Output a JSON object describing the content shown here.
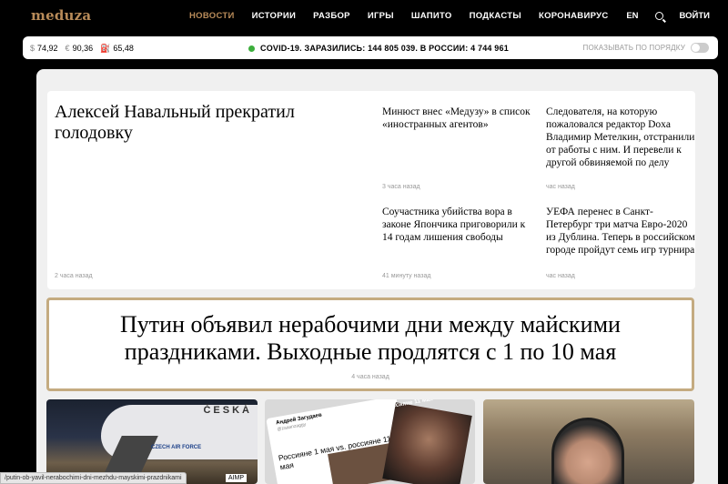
{
  "header": {
    "logo": "meduza",
    "nav": [
      "НОВОСТИ",
      "ИСТОРИИ",
      "РАЗБОР",
      "ИГРЫ",
      "ШАПИТО",
      "ПОДКАСТЫ",
      "КОРОНАВИРУС"
    ],
    "lang": "EN",
    "login": "ВОЙТИ",
    "search_icon": "search-icon"
  },
  "ticker": {
    "usd_sym": "$",
    "usd": "74,92",
    "eur_sym": "€",
    "eur": "90,36",
    "oil_sym": "⛽",
    "oil": "65,48",
    "covid": "COVID-19. ЗАРАЗИЛИСЬ: 144 805 039. В РОССИИ: 4 744 961",
    "order_label": "ПОКАЗЫВАТЬ ПО ПОРЯДКУ"
  },
  "lead": {
    "title": "Алексей Навальный прекратил голодовку",
    "time": "2 часа назад"
  },
  "items": [
    {
      "title": "Минюст внес «Медузу» в список «иностранных агентов»",
      "time": "3 часа назад"
    },
    {
      "title": "Следователя, на которую пожаловался редактор Doxa Владимир Метелкин, отстранили от работы с ним. И перевели к другой обвиняемой по делу",
      "time": "час назад"
    },
    {
      "title": "Соучастника убийства вора в законе Япончика приговорили к 14 годам лишения свободы",
      "time": "41 минуту назад"
    },
    {
      "title": "УЕФА перенес в Санкт-Петербург три матча Евро-2020 из Дублина. Теперь в российском городе пройдут семь игр турнира",
      "time": "час назад"
    }
  ],
  "big": {
    "title": "Путин объявил нерабочими дни между майскими праздниками. Выходные продлятся с 1 по 10 мая",
    "time": "4 часа назад"
  },
  "thumbs": {
    "t1_brand": "ČESKÁ",
    "t1_caf": "CZECH AIR FORCE",
    "t1_tag": "AIMP",
    "t2_name": "Андрей Загудаев",
    "t2_handle": "@zaaanzaggy",
    "t2_text": "Россияне 1 мая vs. россияне 11 мая",
    "t2_overlay": "Россияне 1 мая vs. россияне 11 мая"
  },
  "statusbar": "/putin-ob-yavil-nerabochimi-dni-mezhdu-mayskimi-prazdnikami",
  "colors": {
    "accent": "#b88b59",
    "highlight_border": "#c4ab80",
    "covid_dot": "#3cae3c"
  }
}
